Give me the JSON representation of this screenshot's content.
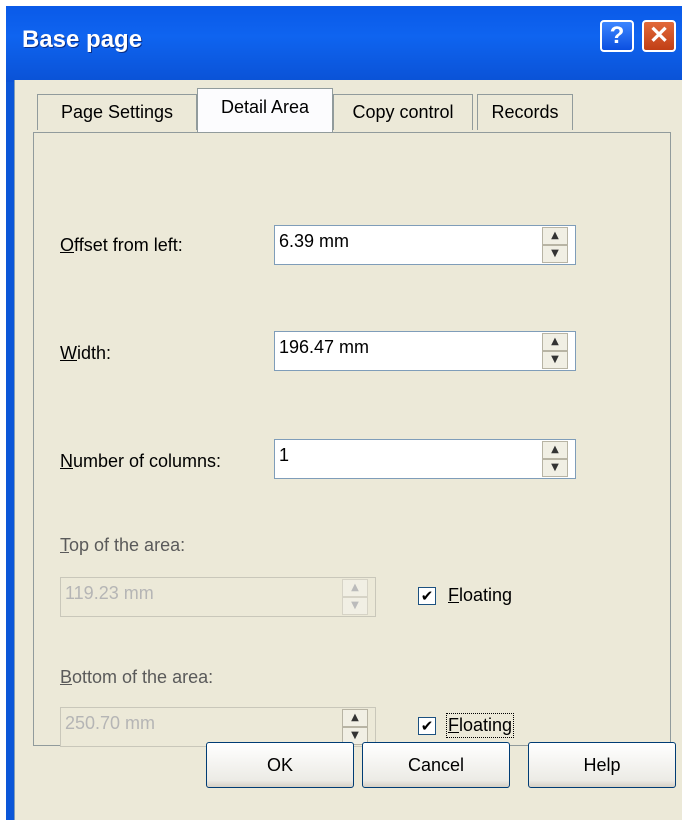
{
  "window": {
    "title": "Base page"
  },
  "titlebar_buttons": {
    "help": "?",
    "close": "✕"
  },
  "tabs": [
    "Page Settings",
    "Detail Area",
    "Copy control",
    "Records"
  ],
  "fields": {
    "offset_label_first": "O",
    "offset_label_rest": "ffset from left:",
    "offset_value": "6.39 mm",
    "width_label_first": "W",
    "width_label_rest": "idth:",
    "width_value": "196.47 mm",
    "columns_label_first": "N",
    "columns_label_rest": "umber of columns:",
    "columns_value": "1",
    "top_label_first": "T",
    "top_label_rest": "op of the area:",
    "top_value": "119.23 mm",
    "bottom_label_first": "B",
    "bottom_label_rest": "ottom of the area:",
    "bottom_value": "250.70 mm"
  },
  "checkboxes": {
    "top_floating_first": "F",
    "top_floating_rest": "loating",
    "top_floating_checked": true,
    "bottom_floating_first": "F",
    "bottom_floating_rest": "loating",
    "bottom_floating_checked": true
  },
  "buttons": {
    "ok": "OK",
    "cancel": "Cancel",
    "help": "Help"
  },
  "icons": {
    "check": "✔",
    "spin_up": "▲",
    "spin_down": "▼"
  },
  "colors": {
    "titlebar": "#0b56d8",
    "dialog_bg": "#ece9d8"
  }
}
